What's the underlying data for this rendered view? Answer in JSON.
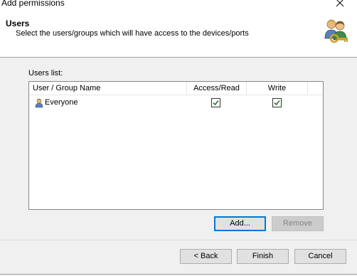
{
  "window": {
    "title": "Add permissions"
  },
  "header": {
    "title": "Users",
    "subtitle": "Select the users/groups which will have access to the devices/ports",
    "icon": "users-key-icon"
  },
  "users": {
    "label": "Users list:",
    "columns": [
      "User / Group Name",
      "Access/Read",
      "Write"
    ],
    "rows": [
      {
        "name": "Everyone",
        "access_read": true,
        "write": true
      }
    ]
  },
  "buttons": {
    "add": "Add...",
    "remove": "Remove",
    "back": "< Back",
    "finish": "Finish",
    "cancel": "Cancel"
  },
  "colors": {
    "focus": "#0078d7",
    "check": "#2a7a2a"
  }
}
